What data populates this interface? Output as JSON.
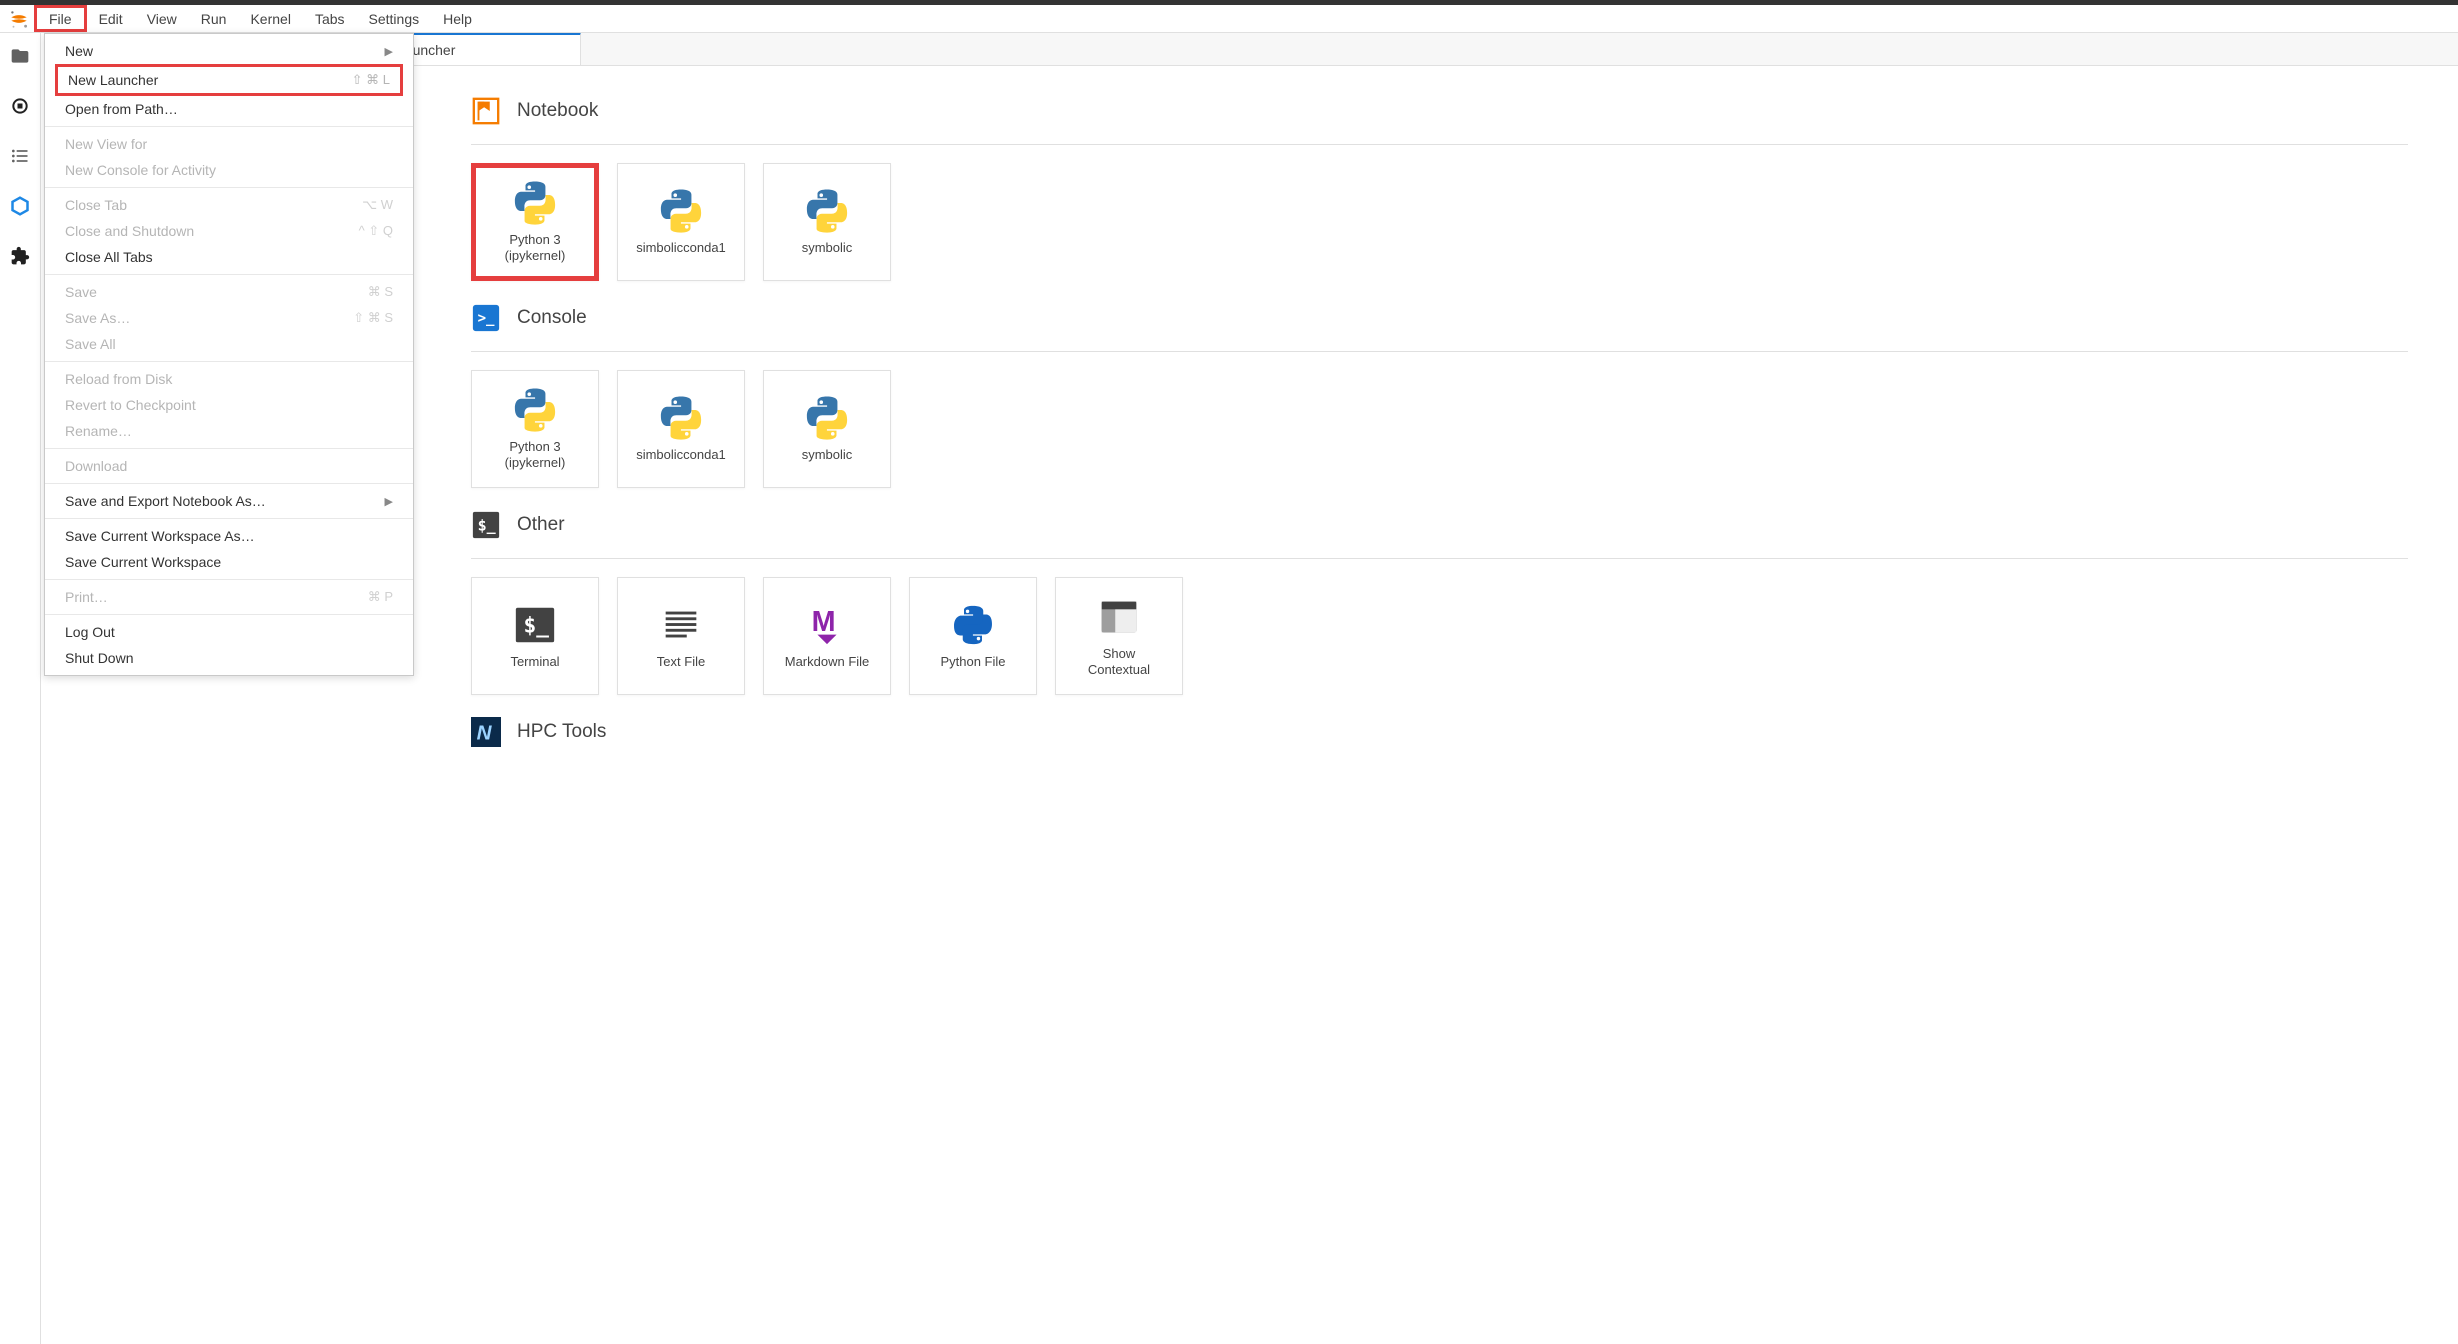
{
  "menu": {
    "items": [
      "File",
      "Edit",
      "View",
      "Run",
      "Kernel",
      "Tabs",
      "Settings",
      "Help"
    ],
    "highlighted_index": 0
  },
  "file_menu": {
    "groups": [
      [
        {
          "label": "New",
          "enabled": true,
          "submenu": true
        },
        {
          "label": "New Launcher",
          "enabled": true,
          "shortcut": "⇧ ⌘ L",
          "highlighted": true
        },
        {
          "label": "Open from Path…",
          "enabled": true
        }
      ],
      [
        {
          "label": "New View for",
          "enabled": false
        },
        {
          "label": "New Console for Activity",
          "enabled": false
        }
      ],
      [
        {
          "label": "Close Tab",
          "enabled": false,
          "shortcut": "⌥ W"
        },
        {
          "label": "Close and Shutdown",
          "enabled": false,
          "shortcut": "^ ⇧ Q"
        },
        {
          "label": "Close All Tabs",
          "enabled": true
        }
      ],
      [
        {
          "label": "Save",
          "enabled": false,
          "shortcut": "⌘ S"
        },
        {
          "label": "Save As…",
          "enabled": false,
          "shortcut": "⇧ ⌘ S"
        },
        {
          "label": "Save All",
          "enabled": false
        }
      ],
      [
        {
          "label": "Reload from Disk",
          "enabled": false
        },
        {
          "label": "Revert to Checkpoint",
          "enabled": false
        },
        {
          "label": "Rename…",
          "enabled": false
        }
      ],
      [
        {
          "label": "Download",
          "enabled": false
        }
      ],
      [
        {
          "label": "Save and Export Notebook As…",
          "enabled": true,
          "submenu": true
        }
      ],
      [
        {
          "label": "Save Current Workspace As…",
          "enabled": true
        },
        {
          "label": "Save Current Workspace",
          "enabled": true
        }
      ],
      [
        {
          "label": "Print…",
          "enabled": false,
          "shortcut": "⌘ P"
        }
      ],
      [
        {
          "label": "Log Out",
          "enabled": true
        },
        {
          "label": "Shut Down",
          "enabled": true
        }
      ]
    ]
  },
  "tab": {
    "title": "Launcher"
  },
  "sidebar": {
    "icons": [
      "folder-icon",
      "running-icon",
      "toc-icon",
      "hex-icon",
      "puzzle-icon"
    ]
  },
  "launcher": {
    "sections": [
      {
        "title": "Notebook",
        "head_icon": "notebook-icon",
        "cards": [
          {
            "label": "Python 3\n(ipykernel)",
            "icon": "python-icon",
            "highlighted": true
          },
          {
            "label": "simbolicconda1",
            "icon": "python-icon"
          },
          {
            "label": "symbolic",
            "icon": "python-icon"
          }
        ]
      },
      {
        "title": "Console",
        "head_icon": "console-icon",
        "cards": [
          {
            "label": "Python 3\n(ipykernel)",
            "icon": "python-icon"
          },
          {
            "label": "simbolicconda1",
            "icon": "python-icon"
          },
          {
            "label": "symbolic",
            "icon": "python-icon"
          }
        ]
      },
      {
        "title": "Other",
        "head_icon": "other-icon",
        "cards": [
          {
            "label": "Terminal",
            "icon": "terminal-icon"
          },
          {
            "label": "Text File",
            "icon": "text-icon"
          },
          {
            "label": "Markdown File",
            "icon": "markdown-icon"
          },
          {
            "label": "Python File",
            "icon": "pyfile-icon"
          },
          {
            "label": "Show\nContextual",
            "icon": "contextual-icon"
          }
        ]
      },
      {
        "title": "HPC Tools",
        "head_icon": "hpc-icon",
        "cards": []
      }
    ]
  }
}
